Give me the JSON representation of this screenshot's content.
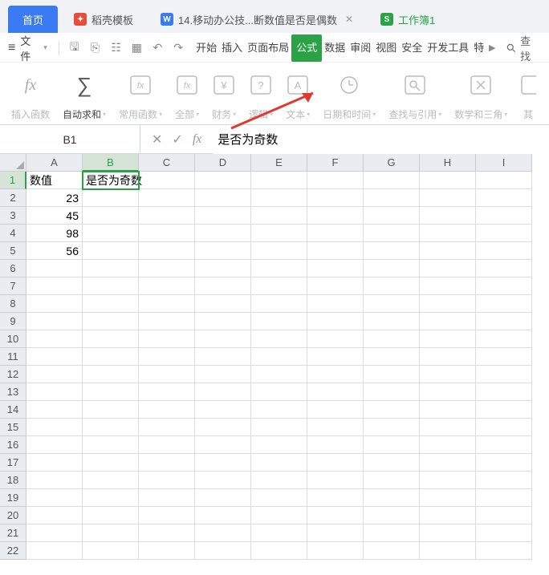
{
  "tabs": {
    "home": "首页",
    "t1": "稻壳模板",
    "t2": "14.移动办公技...断数值是否是偶数",
    "t3": "工作簿1"
  },
  "file_label": "文件",
  "ribbon_tabs": [
    "开始",
    "插入",
    "页面布局",
    "公式",
    "数据",
    "审阅",
    "视图",
    "安全",
    "开发工具",
    "特"
  ],
  "ribbon_active_index": 3,
  "search_label": "查找",
  "groups": {
    "g0": "插入函数",
    "g1": "自动求和",
    "g2": "常用函数",
    "g3": "全部",
    "g4": "财务",
    "g5": "逻辑",
    "g6": "文本",
    "g7": "日期和时间",
    "g8": "查找与引用",
    "g9": "数学和三角",
    "g10": "其"
  },
  "namebox": "B1",
  "formula": "是否为奇数",
  "columns": [
    "A",
    "B",
    "C",
    "D",
    "E",
    "F",
    "G",
    "H",
    "I"
  ],
  "rows": [
    "1",
    "2",
    "3",
    "4",
    "5",
    "6",
    "7",
    "8",
    "9",
    "10",
    "11",
    "12",
    "13",
    "14",
    "15",
    "16",
    "17",
    "18",
    "19",
    "20",
    "21",
    "22"
  ],
  "cells": {
    "A1": "数值",
    "B1": "是否为奇数",
    "A2": "23",
    "A3": "45",
    "A4": "98",
    "A5": "56"
  },
  "active_cell": "B1"
}
